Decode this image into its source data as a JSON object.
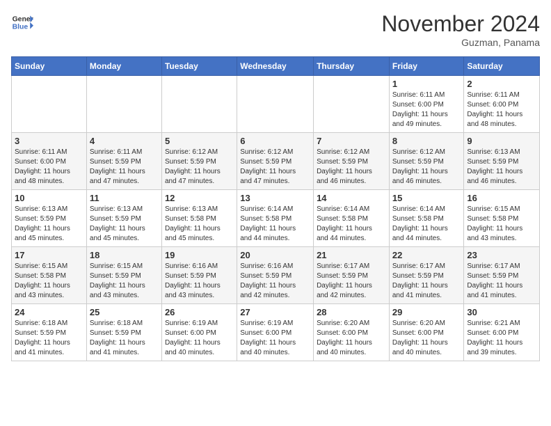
{
  "header": {
    "logo_line1": "General",
    "logo_line2": "Blue",
    "month_title": "November 2024",
    "location": "Guzman, Panama"
  },
  "weekdays": [
    "Sunday",
    "Monday",
    "Tuesday",
    "Wednesday",
    "Thursday",
    "Friday",
    "Saturday"
  ],
  "weeks": [
    [
      {
        "day": "",
        "info": ""
      },
      {
        "day": "",
        "info": ""
      },
      {
        "day": "",
        "info": ""
      },
      {
        "day": "",
        "info": ""
      },
      {
        "day": "",
        "info": ""
      },
      {
        "day": "1",
        "info": "Sunrise: 6:11 AM\nSunset: 6:00 PM\nDaylight: 11 hours\nand 49 minutes."
      },
      {
        "day": "2",
        "info": "Sunrise: 6:11 AM\nSunset: 6:00 PM\nDaylight: 11 hours\nand 48 minutes."
      }
    ],
    [
      {
        "day": "3",
        "info": "Sunrise: 6:11 AM\nSunset: 6:00 PM\nDaylight: 11 hours\nand 48 minutes."
      },
      {
        "day": "4",
        "info": "Sunrise: 6:11 AM\nSunset: 5:59 PM\nDaylight: 11 hours\nand 47 minutes."
      },
      {
        "day": "5",
        "info": "Sunrise: 6:12 AM\nSunset: 5:59 PM\nDaylight: 11 hours\nand 47 minutes."
      },
      {
        "day": "6",
        "info": "Sunrise: 6:12 AM\nSunset: 5:59 PM\nDaylight: 11 hours\nand 47 minutes."
      },
      {
        "day": "7",
        "info": "Sunrise: 6:12 AM\nSunset: 5:59 PM\nDaylight: 11 hours\nand 46 minutes."
      },
      {
        "day": "8",
        "info": "Sunrise: 6:12 AM\nSunset: 5:59 PM\nDaylight: 11 hours\nand 46 minutes."
      },
      {
        "day": "9",
        "info": "Sunrise: 6:13 AM\nSunset: 5:59 PM\nDaylight: 11 hours\nand 46 minutes."
      }
    ],
    [
      {
        "day": "10",
        "info": "Sunrise: 6:13 AM\nSunset: 5:59 PM\nDaylight: 11 hours\nand 45 minutes."
      },
      {
        "day": "11",
        "info": "Sunrise: 6:13 AM\nSunset: 5:59 PM\nDaylight: 11 hours\nand 45 minutes."
      },
      {
        "day": "12",
        "info": "Sunrise: 6:13 AM\nSunset: 5:58 PM\nDaylight: 11 hours\nand 45 minutes."
      },
      {
        "day": "13",
        "info": "Sunrise: 6:14 AM\nSunset: 5:58 PM\nDaylight: 11 hours\nand 44 minutes."
      },
      {
        "day": "14",
        "info": "Sunrise: 6:14 AM\nSunset: 5:58 PM\nDaylight: 11 hours\nand 44 minutes."
      },
      {
        "day": "15",
        "info": "Sunrise: 6:14 AM\nSunset: 5:58 PM\nDaylight: 11 hours\nand 44 minutes."
      },
      {
        "day": "16",
        "info": "Sunrise: 6:15 AM\nSunset: 5:58 PM\nDaylight: 11 hours\nand 43 minutes."
      }
    ],
    [
      {
        "day": "17",
        "info": "Sunrise: 6:15 AM\nSunset: 5:58 PM\nDaylight: 11 hours\nand 43 minutes."
      },
      {
        "day": "18",
        "info": "Sunrise: 6:15 AM\nSunset: 5:59 PM\nDaylight: 11 hours\nand 43 minutes."
      },
      {
        "day": "19",
        "info": "Sunrise: 6:16 AM\nSunset: 5:59 PM\nDaylight: 11 hours\nand 43 minutes."
      },
      {
        "day": "20",
        "info": "Sunrise: 6:16 AM\nSunset: 5:59 PM\nDaylight: 11 hours\nand 42 minutes."
      },
      {
        "day": "21",
        "info": "Sunrise: 6:17 AM\nSunset: 5:59 PM\nDaylight: 11 hours\nand 42 minutes."
      },
      {
        "day": "22",
        "info": "Sunrise: 6:17 AM\nSunset: 5:59 PM\nDaylight: 11 hours\nand 41 minutes."
      },
      {
        "day": "23",
        "info": "Sunrise: 6:17 AM\nSunset: 5:59 PM\nDaylight: 11 hours\nand 41 minutes."
      }
    ],
    [
      {
        "day": "24",
        "info": "Sunrise: 6:18 AM\nSunset: 5:59 PM\nDaylight: 11 hours\nand 41 minutes."
      },
      {
        "day": "25",
        "info": "Sunrise: 6:18 AM\nSunset: 5:59 PM\nDaylight: 11 hours\nand 41 minutes."
      },
      {
        "day": "26",
        "info": "Sunrise: 6:19 AM\nSunset: 6:00 PM\nDaylight: 11 hours\nand 40 minutes."
      },
      {
        "day": "27",
        "info": "Sunrise: 6:19 AM\nSunset: 6:00 PM\nDaylight: 11 hours\nand 40 minutes."
      },
      {
        "day": "28",
        "info": "Sunrise: 6:20 AM\nSunset: 6:00 PM\nDaylight: 11 hours\nand 40 minutes."
      },
      {
        "day": "29",
        "info": "Sunrise: 6:20 AM\nSunset: 6:00 PM\nDaylight: 11 hours\nand 40 minutes."
      },
      {
        "day": "30",
        "info": "Sunrise: 6:21 AM\nSunset: 6:00 PM\nDaylight: 11 hours\nand 39 minutes."
      }
    ]
  ]
}
